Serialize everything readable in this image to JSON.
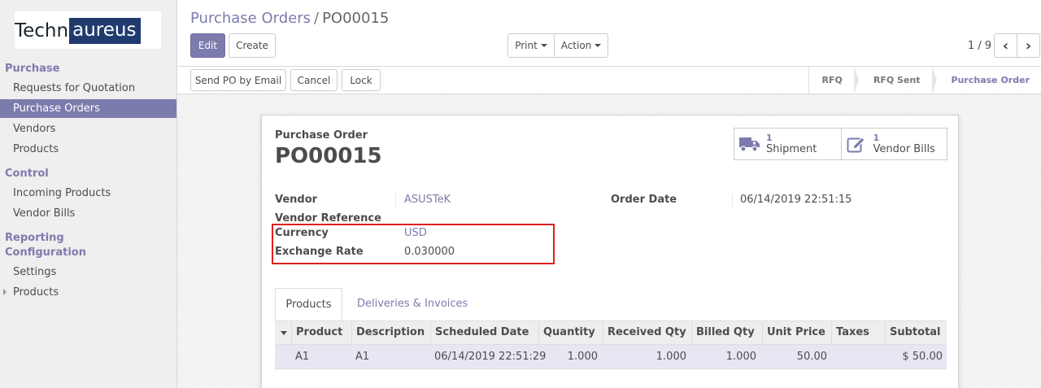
{
  "logo": {
    "text_left": "Techn",
    "text_right": "aureus"
  },
  "sidebar": {
    "sections": [
      {
        "title": "Purchase",
        "items": [
          {
            "label": "Requests for Quotation"
          },
          {
            "label": "Purchase Orders",
            "active": true
          },
          {
            "label": "Vendors"
          },
          {
            "label": "Products"
          }
        ]
      },
      {
        "title": "Control",
        "items": [
          {
            "label": "Incoming Products"
          },
          {
            "label": "Vendor Bills"
          }
        ]
      },
      {
        "title": "Reporting",
        "items": []
      },
      {
        "title": "Configuration",
        "items": [
          {
            "label": "Settings"
          },
          {
            "label": "Products"
          }
        ]
      }
    ]
  },
  "breadcrumb": {
    "parent": "Purchase Orders",
    "separator": "/",
    "current": "PO00015"
  },
  "toolbar": {
    "edit": "Edit",
    "create": "Create",
    "print": "Print",
    "action": "Action"
  },
  "pager": {
    "text": "1 / 9",
    "prev": "‹",
    "next": "›"
  },
  "status_buttons": {
    "send_po": "Send PO by Email",
    "cancel": "Cancel",
    "lock": "Lock"
  },
  "stages": [
    {
      "label": "RFQ"
    },
    {
      "label": "RFQ Sent"
    },
    {
      "label": "Purchase Order",
      "current": true
    }
  ],
  "form": {
    "label": "Purchase Order",
    "name": "PO00015",
    "smart_buttons": [
      {
        "count": "1",
        "label": "Shipment",
        "icon": "truck-icon"
      },
      {
        "count": "1",
        "label": "Vendor Bills",
        "icon": "pencil-square-icon"
      }
    ],
    "fields": {
      "vendor": {
        "label": "Vendor",
        "value": "ASUSTeK"
      },
      "vendor_reference": {
        "label": "Vendor Reference",
        "value": ""
      },
      "currency": {
        "label": "Currency",
        "value": "USD"
      },
      "exchange_rate": {
        "label": "Exchange Rate",
        "value": "0.030000"
      },
      "order_date": {
        "label": "Order Date",
        "value": "06/14/2019 22:51:15"
      }
    },
    "tabs": [
      {
        "label": "Products",
        "active": true
      },
      {
        "label": "Deliveries & Invoices"
      }
    ],
    "table": {
      "columns": [
        "Product",
        "Description",
        "Scheduled Date",
        "Quantity",
        "Received Qty",
        "Billed Qty",
        "Unit Price",
        "Taxes",
        "Subtotal"
      ],
      "rows": [
        {
          "product": "A1",
          "description": "A1",
          "scheduled_date": "06/14/2019 22:51:29",
          "quantity": "1.000",
          "received_qty": "1.000",
          "billed_qty": "1.000",
          "unit_price": "50.00",
          "taxes": "",
          "subtotal": "$ 50.00"
        }
      ]
    }
  },
  "colors": {
    "accent": "#7c7bad",
    "highlight_box": "#e01f1f"
  }
}
